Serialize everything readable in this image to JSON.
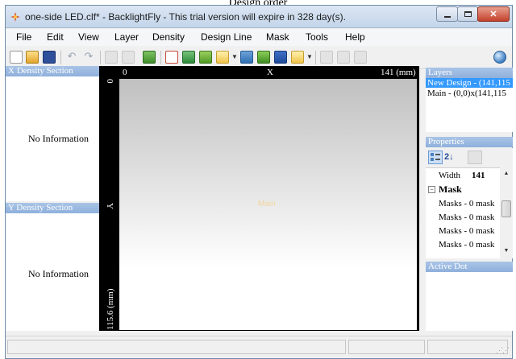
{
  "caption": "Design order",
  "window": {
    "title": "one-side LED.clf* - BacklightFly - This trial version will expire in 328 day(s)."
  },
  "menu": [
    "File",
    "Edit",
    "View",
    "Layer",
    "Density",
    "Design Line",
    "Mask",
    "Tools",
    "Help"
  ],
  "left_panels": {
    "x_density": {
      "header": "X Density Section",
      "message": "No Information"
    },
    "y_density": {
      "header": "Y Density Section",
      "message": "No Information"
    }
  },
  "canvas": {
    "x_start": "0",
    "x_axis_label": "X",
    "x_end": "141 (mm)",
    "y_start": "0",
    "y_axis_label": "Y",
    "y_end": "115.6 (mm)",
    "design_label": "Main"
  },
  "layers": {
    "header": "Layers",
    "items": [
      {
        "label": "New Design - (141,115",
        "selected": true
      },
      {
        "label": "Main - (0,0)x(141,115",
        "selected": false
      }
    ]
  },
  "properties": {
    "header": "Properties",
    "width_key": "Width",
    "width_value": "141",
    "category": "Mask",
    "masks": [
      "Masks - 0 mask",
      "Masks - 0 mask",
      "Masks - 0 mask",
      "Masks - 0 mask"
    ]
  },
  "active_dot": {
    "header": "Active Dot"
  },
  "icons": {
    "toolbar": [
      "new-icon",
      "open-icon",
      "save-icon",
      "undo-icon",
      "redo-icon",
      "select-icon",
      "zoom-icon",
      "density-icon",
      "add-dot-icon",
      "layer-icon",
      "layer-green-icon",
      "folder-icon",
      "chart-icon",
      "mask-icon",
      "dot-icon",
      "export-icon",
      "grid-icon",
      "view-icon",
      "table-icon",
      "globe-icon"
    ]
  },
  "colors": {
    "panel_header": "#8fb0dc",
    "selection": "#3399ff",
    "canvas_frame": "#000000"
  }
}
